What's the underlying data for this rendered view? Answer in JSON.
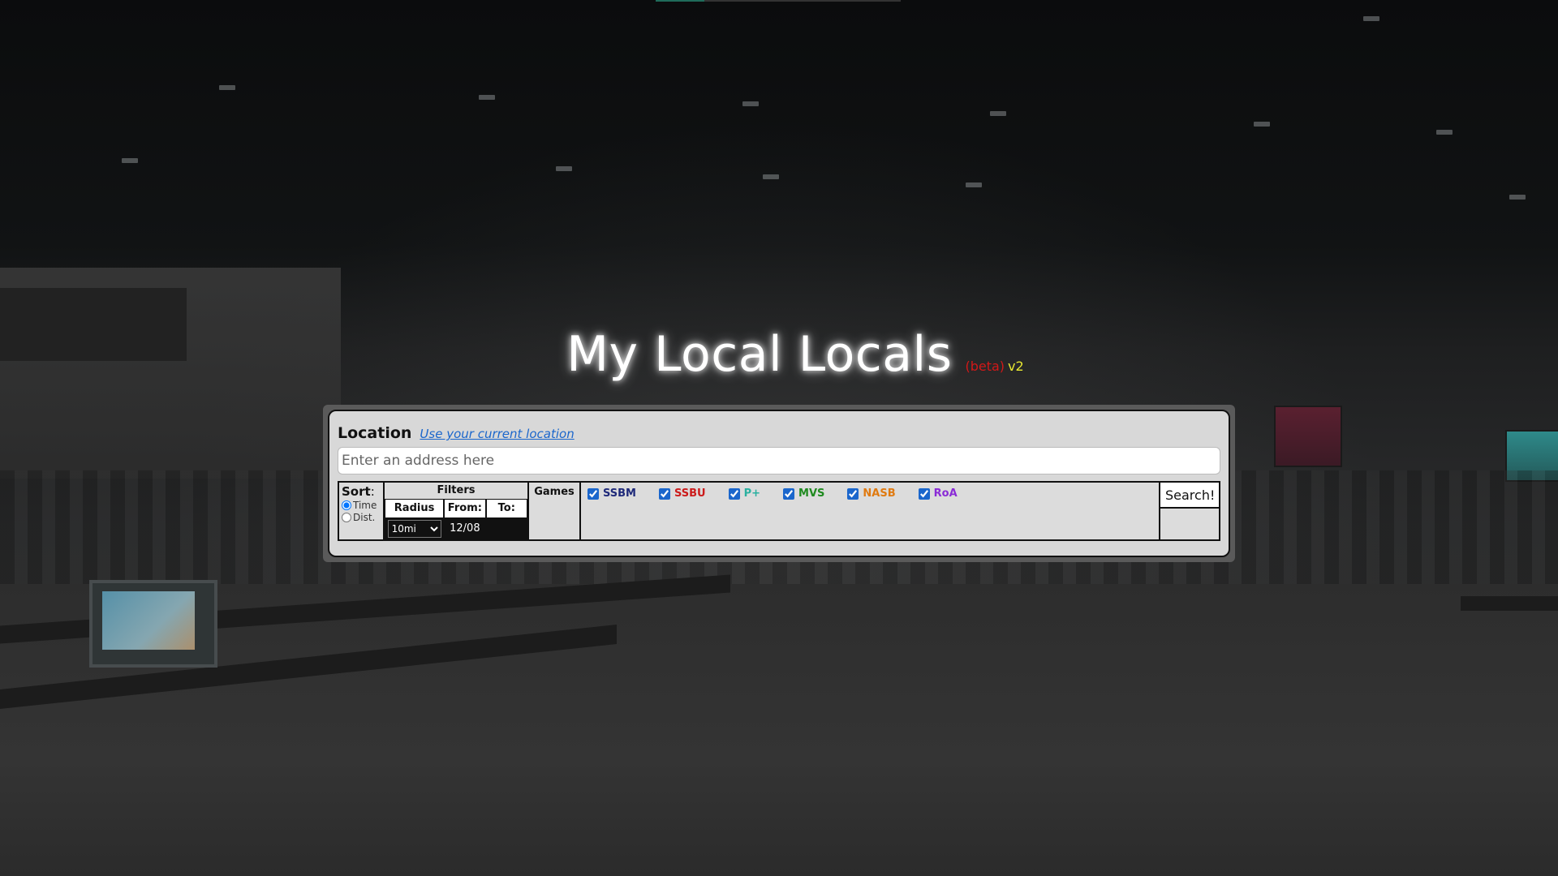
{
  "header": {
    "title": "My Local Locals",
    "beta": "(beta)",
    "version": "v2"
  },
  "location": {
    "label": "Location",
    "use_current_link": "Use your current location",
    "address_placeholder": "Enter an address here",
    "address_value": ""
  },
  "sort": {
    "title": "Sort",
    "colon": ":",
    "options": [
      {
        "label": "Time",
        "checked": true
      },
      {
        "label": "Dist.",
        "checked": false
      }
    ]
  },
  "filters": {
    "title": "Filters",
    "radius_label": "Radius",
    "radius_value": "10mi",
    "from_label": "From:",
    "from_value": "12/08",
    "to_label": "To:",
    "to_value": ""
  },
  "games": {
    "label": "Games",
    "items": [
      {
        "label": "SSBM",
        "checked": true,
        "color": "#1f2a7a"
      },
      {
        "label": "SSBU",
        "checked": true,
        "color": "#cc1b1b"
      },
      {
        "label": "P+",
        "checked": true,
        "color": "#2ab0a0"
      },
      {
        "label": "MVS",
        "checked": true,
        "color": "#1f8a1f"
      },
      {
        "label": "NASB",
        "checked": true,
        "color": "#e07a10"
      },
      {
        "label": "RoA",
        "checked": true,
        "color": "#8a2bd6"
      }
    ]
  },
  "search": {
    "button_label": "Search!"
  },
  "colors": {
    "title": "#ffffff",
    "beta": "#d21818",
    "version": "#e8e832",
    "link": "#1a66cc"
  }
}
